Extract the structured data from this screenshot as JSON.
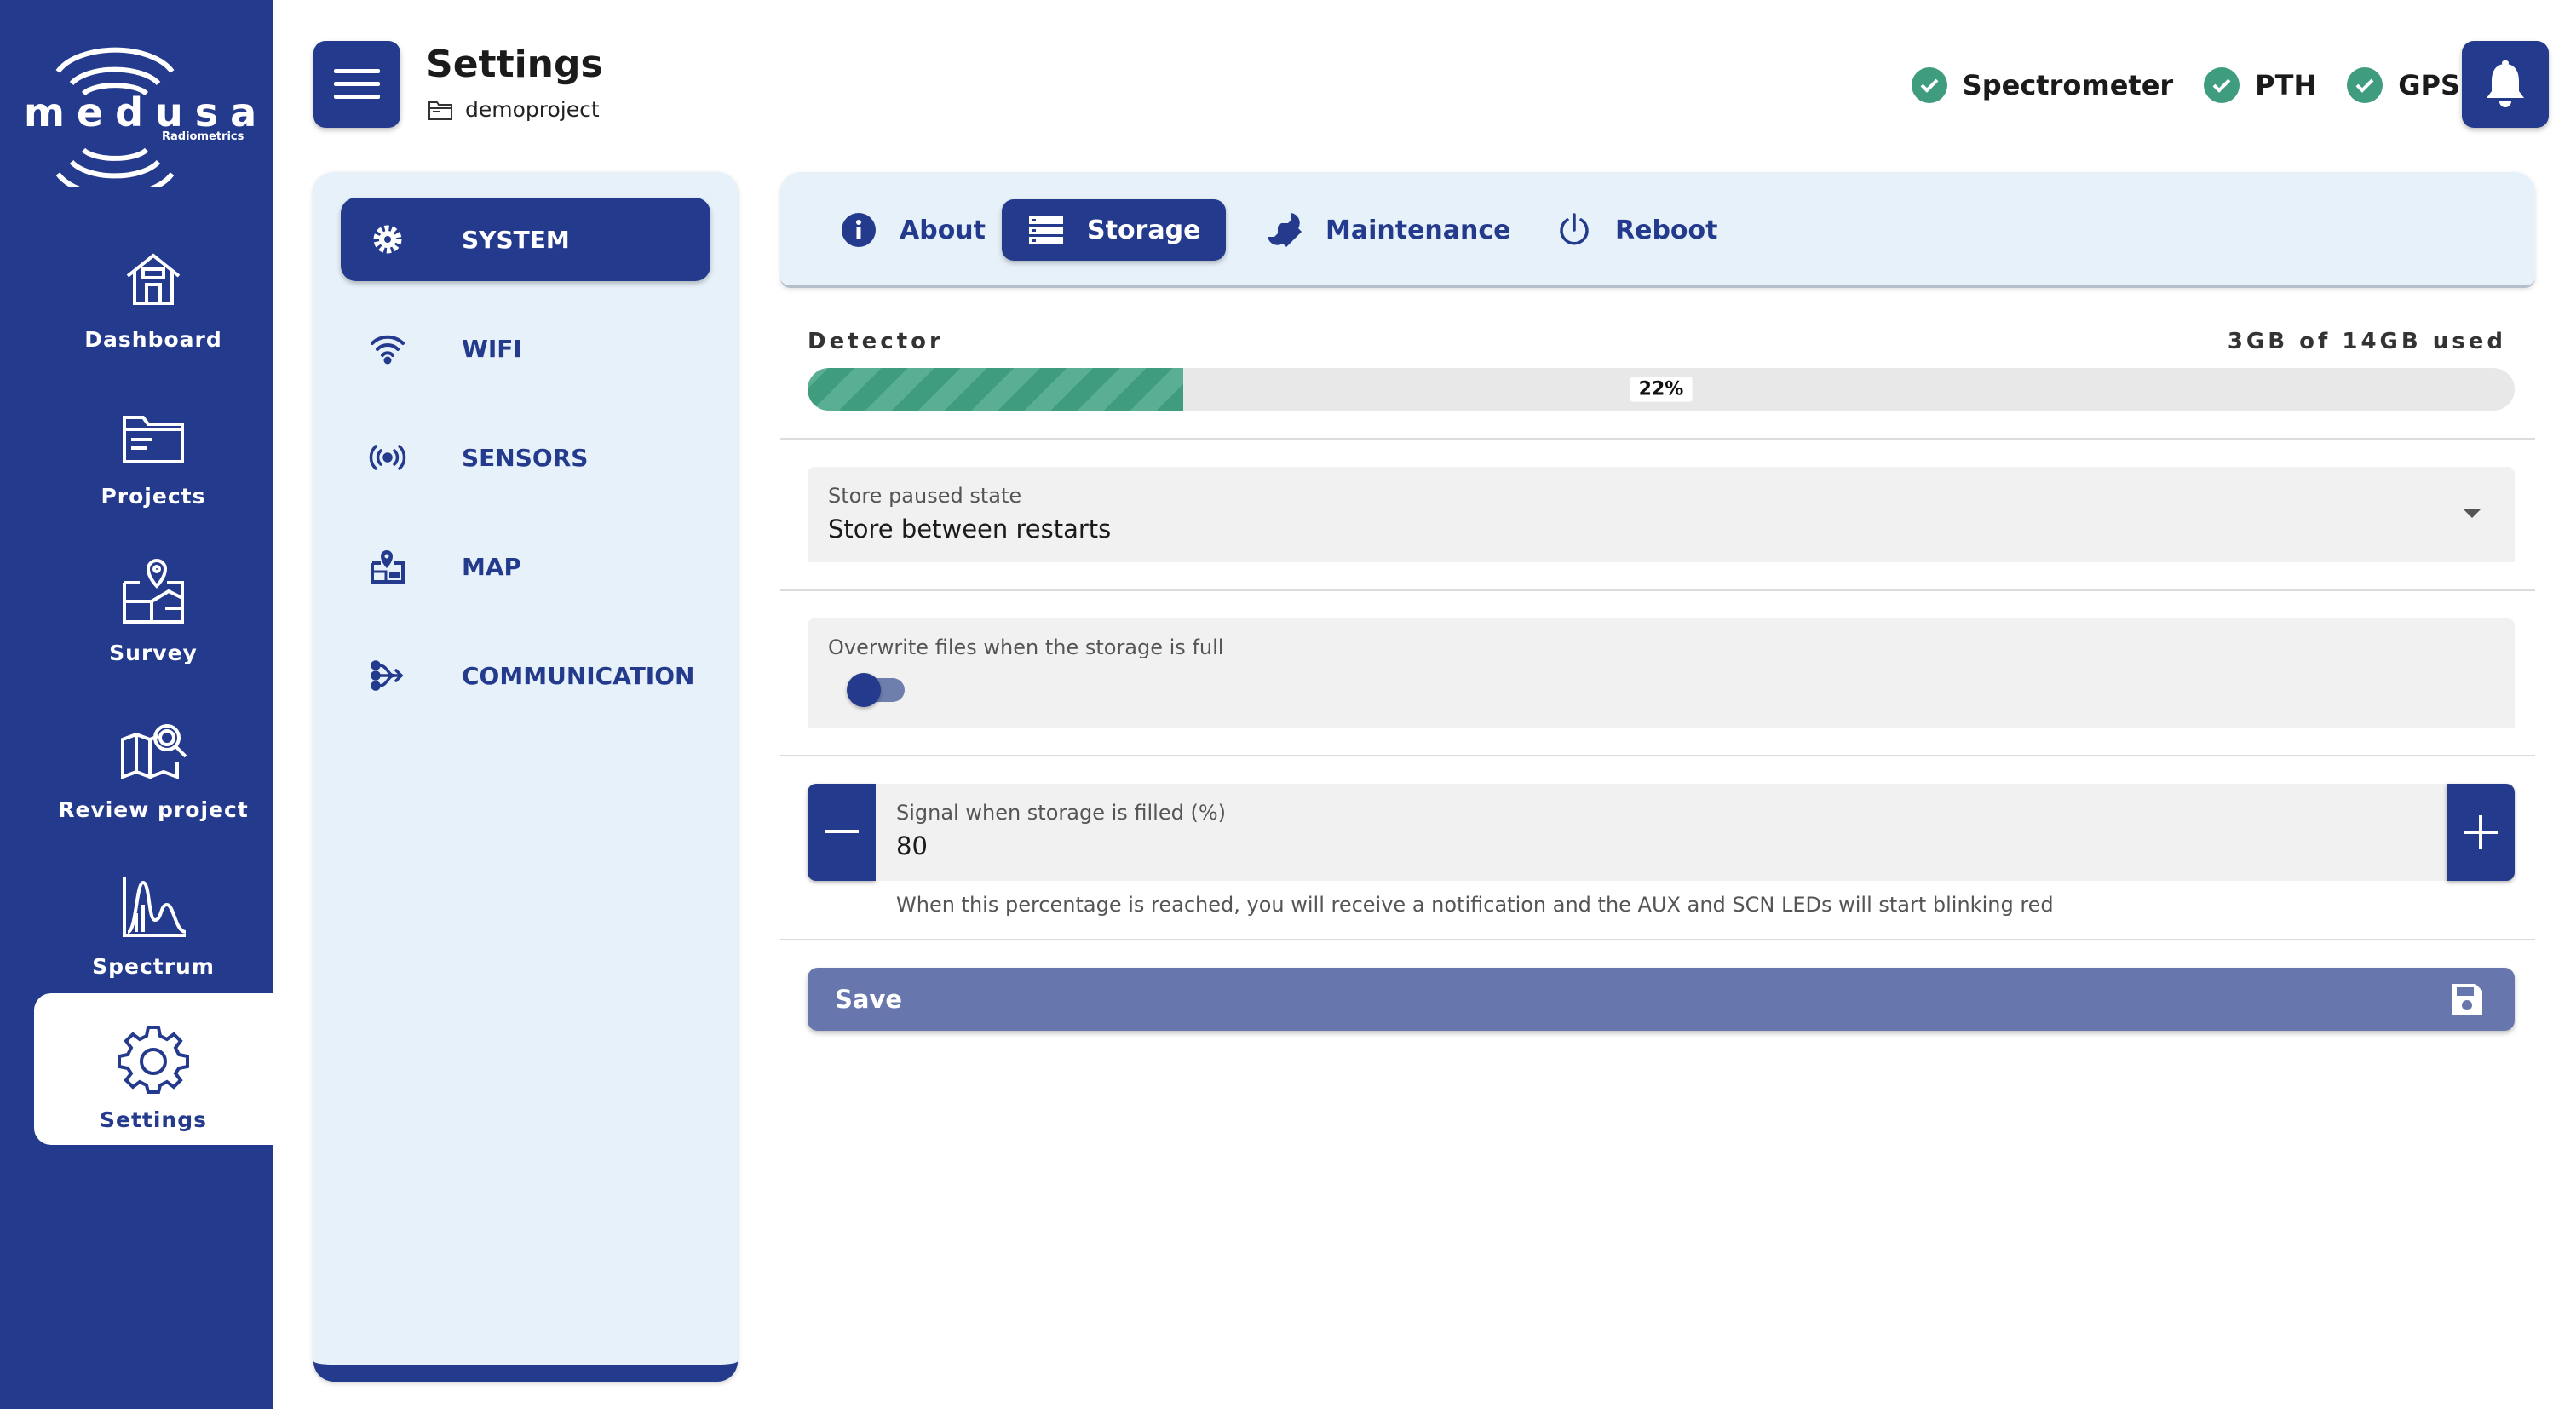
{
  "app": {
    "logo_text": "medusa",
    "logo_sub": "Radiometrics"
  },
  "nav": {
    "items": [
      {
        "label": "Dashboard",
        "icon": "home-icon"
      },
      {
        "label": "Projects",
        "icon": "folder-icon"
      },
      {
        "label": "Survey",
        "icon": "map-pin-icon"
      },
      {
        "label": "Review project",
        "icon": "map-search-icon"
      },
      {
        "label": "Spectrum",
        "icon": "spectrum-chart-icon"
      },
      {
        "label": "Settings",
        "icon": "gear-icon"
      }
    ],
    "active": "Settings"
  },
  "header": {
    "title": "Settings",
    "project": "demoproject",
    "statuses": [
      {
        "label": "Spectrometer",
        "ok": true
      },
      {
        "label": "PTH",
        "ok": true
      },
      {
        "label": "GPS",
        "ok": true
      }
    ]
  },
  "categories": {
    "items": [
      {
        "label": "SYSTEM",
        "icon": "gear-icon"
      },
      {
        "label": "WIFI",
        "icon": "wifi-icon"
      },
      {
        "label": "SENSORS",
        "icon": "sensor-icon"
      },
      {
        "label": "MAP",
        "icon": "map-icon"
      },
      {
        "label": "COMMUNICATION",
        "icon": "communication-icon"
      }
    ],
    "active": "SYSTEM"
  },
  "tabs": {
    "items": [
      {
        "label": "About",
        "icon": "info-icon"
      },
      {
        "label": "Storage",
        "icon": "storage-icon"
      },
      {
        "label": "Maintenance",
        "icon": "wrench-icon"
      },
      {
        "label": "Reboot",
        "icon": "power-icon"
      }
    ],
    "active": "Storage"
  },
  "storage": {
    "detector_label": "Detector",
    "used_text": "3GB of 14GB used",
    "percent_text": "22%",
    "percent_value": 22,
    "paused_state": {
      "label": "Store paused state",
      "value": "Store between restarts"
    },
    "overwrite": {
      "label": "Overwrite files when the storage is full",
      "enabled": true
    },
    "signal": {
      "label": "Signal when storage is filled (%)",
      "value": "80",
      "helper": "When this percentage is reached, you will receive a notification and the AUX and SCN LEDs will start blinking red"
    },
    "save_label": "Save"
  },
  "colors": {
    "primary": "#243a8c",
    "panel": "#e7f1fa",
    "success": "#3f9c7f",
    "save": "#6776ad"
  }
}
